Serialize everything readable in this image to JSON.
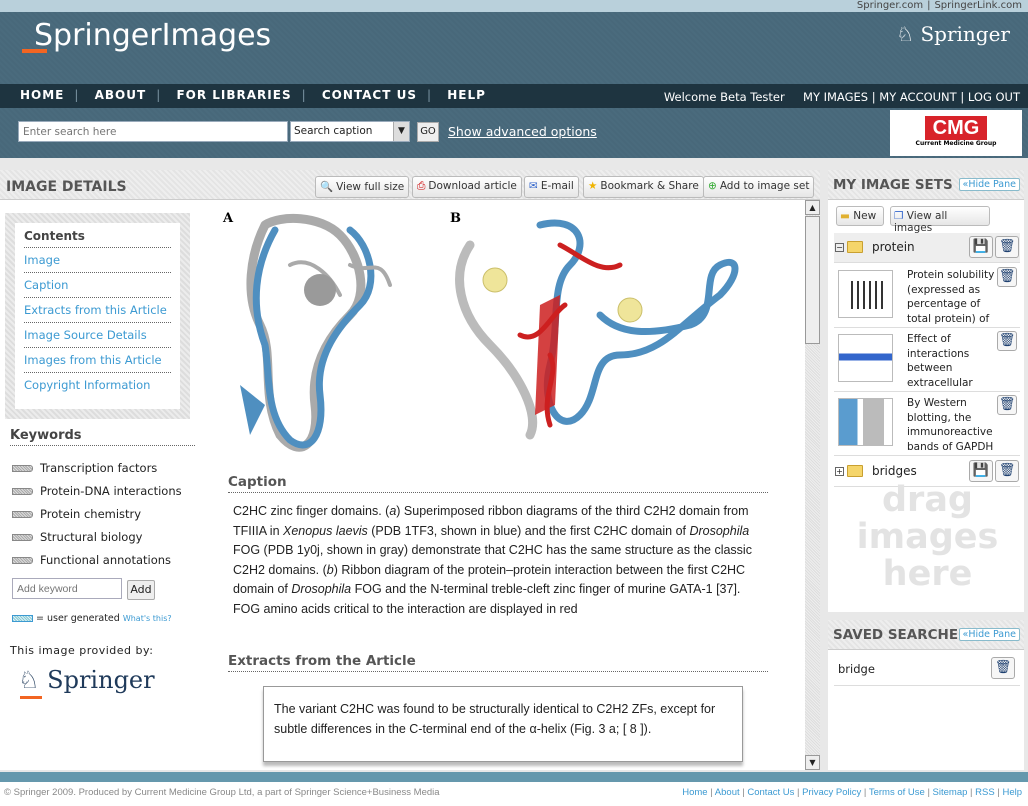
{
  "top_links": [
    "Springer.com",
    "|",
    "SpringerLink.com"
  ],
  "header": {
    "logo": "SpringerImages",
    "brand": "Springer"
  },
  "nav": {
    "items": [
      "HOME",
      "ABOUT",
      "FOR LIBRARIES",
      "CONTACT US",
      "HELP"
    ],
    "welcome": "Welcome Beta Tester",
    "user_links": [
      "MY IMAGES",
      "MY ACCOUNT",
      "LOG OUT"
    ]
  },
  "search": {
    "placeholder": "Enter search here",
    "scope": "Search caption",
    "go": "GO",
    "advanced": "Show advanced options"
  },
  "sponsor": {
    "logo": "CMG",
    "sub": "Current Medicine Group"
  },
  "main": {
    "title": "IMAGE DETAILS",
    "toolbar": [
      "View full size",
      "Download article",
      "E-mail",
      "Bookmark & Share",
      "Add to image set"
    ]
  },
  "contents": {
    "title": "Contents",
    "items": [
      "Image",
      "Caption",
      "Extracts from this Article",
      "Image Source Details",
      "Images from this Article",
      "Copyright Information"
    ]
  },
  "keywords": {
    "title": "Keywords",
    "items": [
      "Transcription factors",
      "Protein-DNA interactions",
      "Protein chemistry",
      "Structural biology",
      "Functional annotations"
    ],
    "placeholder": "Add keyword",
    "add": "Add",
    "legend": "= user generated",
    "whats_this": "What's this?"
  },
  "provider": {
    "label": "This image provided by:",
    "logo": "Springer"
  },
  "figure": {
    "label_a": "A",
    "label_b": "B"
  },
  "caption": {
    "title": "Caption",
    "segments": [
      "C2HC zinc finger domains. (",
      "a",
      ") Superimposed ribbon diagrams of the third C2H2 domain from TFIIIA in ",
      "Xenopus laevis",
      " (PDB 1TF3, shown in blue) and the first C2HC domain of ",
      "Drosophila",
      " FOG (PDB 1y0j, shown in gray) demonstrate that C2HC has the same structure as the classic C2H2 domains. (",
      "b",
      ") Ribbon diagram of the protein–protein interaction between the first C2HC domain of ",
      "Drosophila",
      " FOG and the N-terminal treble-cleft zinc finger of murine GATA-1 [37]. FOG amino acids critical to the interaction are displayed in red"
    ]
  },
  "extracts": {
    "title": "Extracts from the Article",
    "text": "The variant C2HC was found to be structurally identical to C2H2 ZFs, except for subtle differences in the C-terminal end of the α-helix (Fig.  3 a; [ 8 ])."
  },
  "image_sets": {
    "title": "MY IMAGE SETS",
    "hide": "«Hide Pane",
    "new": "New",
    "view_all": "View all images",
    "folders": [
      {
        "name": "protein",
        "expanded": true,
        "items": [
          "Protein solubility (expressed as percentage of total protein) of",
          "Effect of interactions between extracellular",
          "By Western blotting, the immunoreactive bands of GAPDH"
        ]
      },
      {
        "name": "bridges",
        "expanded": false
      }
    ],
    "drop_hint": "drag images here"
  },
  "saved_searches": {
    "title": "SAVED SEARCHES",
    "hide": "«Hide Pane",
    "items": [
      "bridge"
    ]
  },
  "footer": {
    "copyright": "© Springer 2009. Produced by Current Medicine Group Ltd, a part of Springer Science+Business Media",
    "links": [
      "Home",
      "About",
      "Contact Us",
      "Privacy Policy",
      "Terms of Use",
      "Sitemap",
      "RSS",
      "Help"
    ]
  },
  "colors": {
    "header": "#48687a",
    "nav": "#1e3440",
    "link": "#3c9ad2",
    "accent": "#f26522",
    "footer_bar": "#6598ad"
  }
}
